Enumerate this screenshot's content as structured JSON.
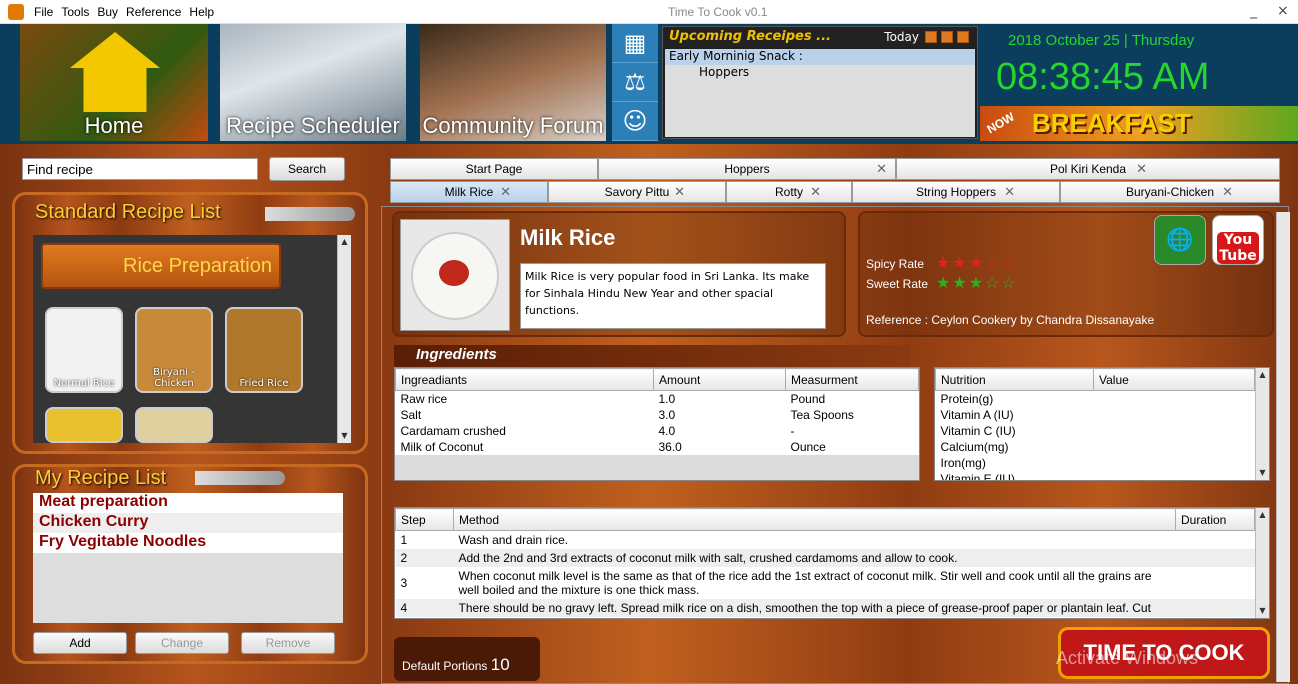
{
  "window": {
    "title": "Time To Cook  v0.1",
    "minimize": "_",
    "close": "×"
  },
  "menu": [
    "File",
    "Tools",
    "Buy",
    "Reference",
    "Help"
  ],
  "nav": {
    "home": "Home",
    "scheduler": "Recipe Scheduler",
    "forum": "Community Forum"
  },
  "upcoming": {
    "title": "Upcoming Receipes ...",
    "today": "Today",
    "meal": "Early Morninig Snack :",
    "item": "Hoppers"
  },
  "clock": {
    "date": "2018 October 25 | Thursday",
    "time": "08:38:45 AM",
    "meal_banner": "BREAKFAST",
    "badge": "NOW"
  },
  "search": {
    "placeholder": "Find recipe",
    "value": "Find recipe",
    "button": "Search"
  },
  "standard_list": {
    "title": "Standard Recipe List",
    "category": "Rice Preparation",
    "items": [
      "Normal Rice",
      "Biryani - Chicken",
      "Fried Rice"
    ]
  },
  "my_list": {
    "title": "My Recipe List",
    "items": [
      "Meat preparation",
      "Chicken Curry",
      "Fry Vegitable Noodles"
    ],
    "add": "Add",
    "change": "Change",
    "remove": "Remove"
  },
  "tabs_row1": [
    "Start Page",
    "Hoppers",
    "Pol Kiri Kenda"
  ],
  "tabs_row2": [
    "Milk Rice",
    "Savory Pittu",
    "Rotty",
    "String Hoppers",
    "Buryani-Chicken"
  ],
  "recipe": {
    "name": "Milk Rice",
    "description": "Milk Rice is very popular food in Sri Lanka. Its make for Sinhala Hindu New Year and other spacial functions.",
    "spicy_label": "Spicy Rate",
    "spicy_rating": 3,
    "spicy_max": 5,
    "sweet_label": "Sweet Rate",
    "sweet_rating": 3,
    "sweet_max": 5,
    "reference": "Reference : Ceylon Cookery by Chandra Dissanayake",
    "youtube": "You Tube"
  },
  "ingredients": {
    "title": "Ingredients",
    "headers": [
      "Ingreadiants",
      "Amount",
      "Measurment"
    ],
    "rows": [
      [
        "Raw rice",
        "1.0",
        "Pound"
      ],
      [
        "Salt",
        "3.0",
        "Tea Spoons"
      ],
      [
        "Cardamam crushed",
        "4.0",
        "-"
      ],
      [
        "Milk of Coconut",
        "36.0",
        "Ounce"
      ]
    ]
  },
  "nutrition": {
    "headers": [
      "Nutrition",
      "Value"
    ],
    "rows": [
      "Protein(g)",
      "Vitamin A (IU)",
      "Vitamin C (IU)",
      "Calcium(mg)",
      "Iron(mg)",
      "Vitamin E (IU)"
    ]
  },
  "method": {
    "headers": [
      "Step",
      "Method",
      "Duration"
    ],
    "rows": [
      [
        "1",
        "Wash and drain rice."
      ],
      [
        "2",
        "Add the 2nd and 3rd extracts of coconut milk with salt, crushed cardamoms and allow to cook."
      ],
      [
        "3",
        "When coconut milk level is the same as that of the rice add the 1st extract of coconut milk. Stir well and cook until all the grains are well boiled and the mixture is one thick mass."
      ],
      [
        "4",
        "There should be no gravy left. Spread milk rice on a dish, smoothen the top with a piece of grease-proof paper or plantain leaf. Cut"
      ]
    ]
  },
  "portions": {
    "label": "Default Portions",
    "value": "10"
  },
  "logo": "TIME TO COOK",
  "watermark": "Activate Windows",
  "colors": {
    "accent": "#23d630",
    "wood": "#b6541c",
    "list_text": "#8b0000"
  }
}
